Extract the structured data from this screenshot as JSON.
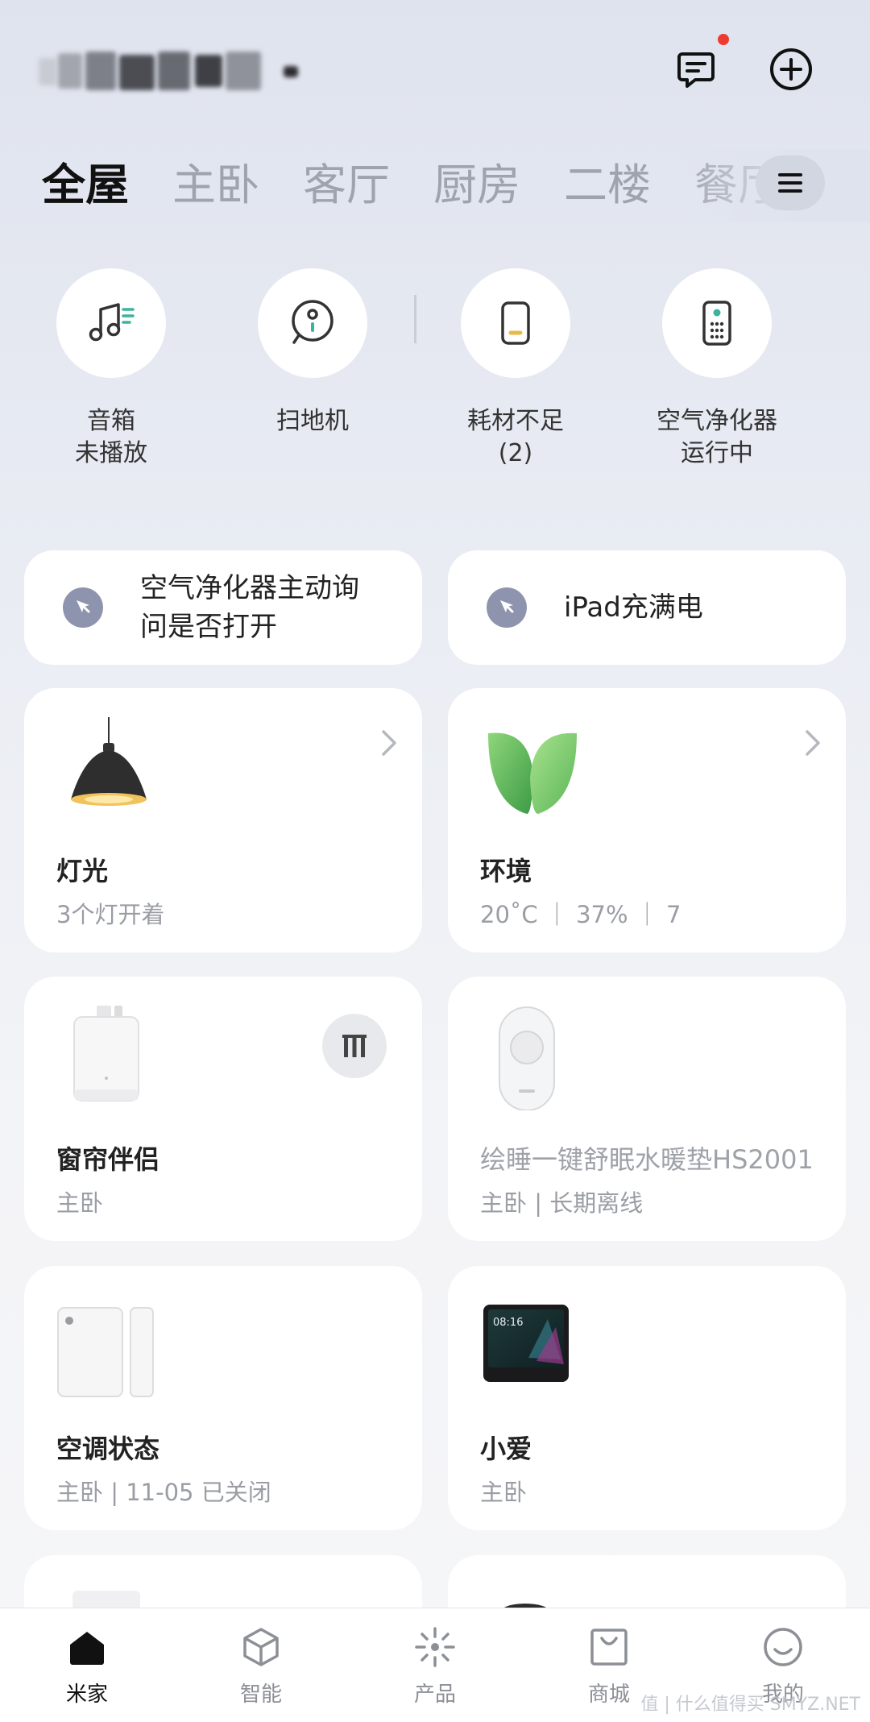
{
  "header": {
    "home_name_blurred": true,
    "notification_icon": "message-icon",
    "add_icon": "plus-circle-icon",
    "notification_dot_color": "#ef3b2f"
  },
  "rooms": {
    "tabs": [
      "全屋",
      "主卧",
      "客厅",
      "厨房",
      "二楼",
      "餐厅"
    ],
    "active_index": 0,
    "menu_icon": "hamburger-icon"
  },
  "quick": [
    {
      "icon": "music-note-icon",
      "line1": "音箱",
      "line2": "未播放"
    },
    {
      "icon": "robot-vacuum-icon",
      "line1": "扫地机",
      "line2": ""
    },
    {
      "icon": "consumable-icon",
      "line1": "耗材不足",
      "line2": "(2)"
    },
    {
      "icon": "air-purifier-icon",
      "line1": "空气净化器",
      "line2": "运行中"
    }
  ],
  "scenes": [
    {
      "icon": "cursor-icon",
      "line1": "空气净化器主动询",
      "line2": "问是否打开"
    },
    {
      "icon": "cursor-icon",
      "line1": "iPad充满电",
      "line2": ""
    }
  ],
  "cards": [
    {
      "icon": "pendant-lamp-icon",
      "name": "灯光",
      "sub": "3个灯开着",
      "chevron": true
    },
    {
      "icon": "leaf-icon",
      "name": "环境",
      "sub": "20˚C ｜ 37% ｜ 7",
      "chevron": true
    },
    {
      "icon": "curtain-companion-icon",
      "name": "窗帘伴侣",
      "sub": "主卧",
      "action_icon": "pause-icon"
    },
    {
      "icon": "water-pad-icon",
      "name": "绘睡一键舒眠水暖垫HS2001",
      "sub": "主卧 | 长期离线",
      "offline": true
    },
    {
      "icon": "door-sensor-icon",
      "name": "空调状态",
      "sub": "主卧 | 11-05 已关闭"
    },
    {
      "icon": "smart-display-icon",
      "name": "小爱",
      "sub": "主卧",
      "screen_time": "08:16"
    }
  ],
  "nav": [
    {
      "icon": "home-icon",
      "label": "米家",
      "active": true
    },
    {
      "icon": "cube-icon",
      "label": "智能",
      "active": false
    },
    {
      "icon": "sparkle-icon",
      "label": "产品",
      "active": false
    },
    {
      "icon": "shopping-bag-icon",
      "label": "商城",
      "active": false
    },
    {
      "icon": "smile-icon",
      "label": "我的",
      "active": false
    }
  ],
  "watermark": "值 | 什么值得买 SMYZ.NET",
  "colors": {
    "accent_green": "#3db39e",
    "consumable_yellow": "#e6b94a",
    "scene_icon_bg": "#8e94ad"
  }
}
